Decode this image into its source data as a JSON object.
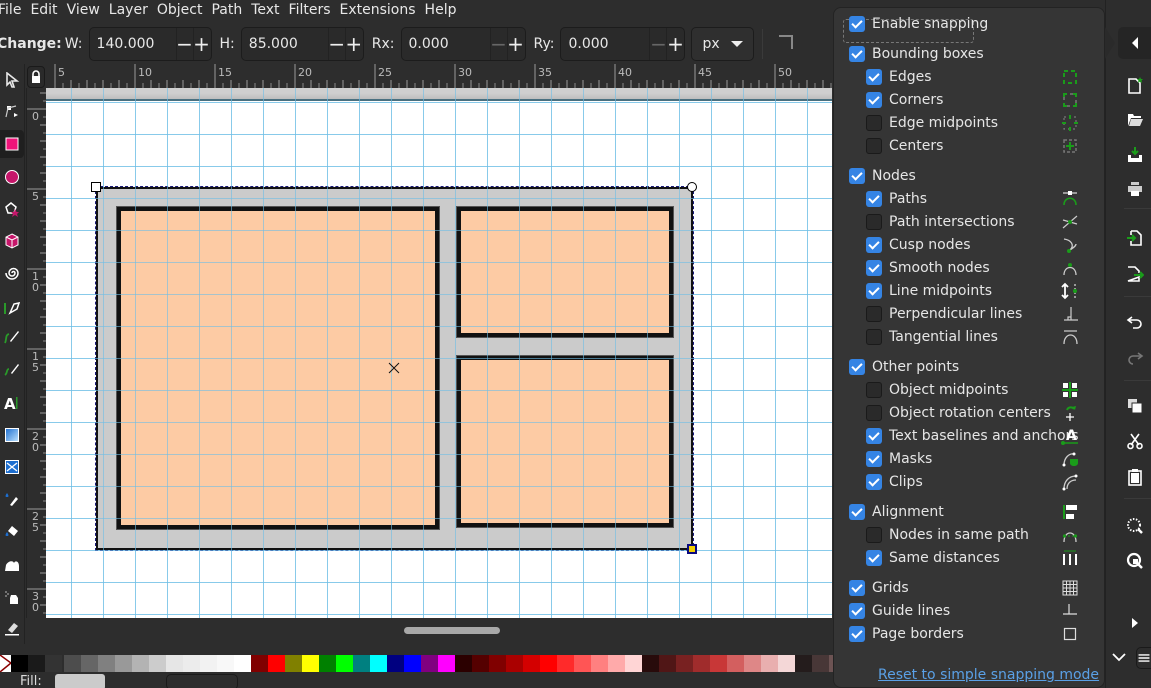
{
  "menubar": [
    "File",
    "Edit",
    "View",
    "Layer",
    "Object",
    "Path",
    "Text",
    "Filters",
    "Extensions",
    "Help"
  ],
  "toolbar": {
    "change_label": "Change:",
    "w_label": "W:",
    "w_value": "140.000",
    "h_label": "H:",
    "h_value": "85.000",
    "rx_label": "Rx:",
    "rx_value": "0.000",
    "ry_label": "Ry:",
    "ry_value": "0.000",
    "unit": "px"
  },
  "tools": [
    {
      "name": "selector-tool",
      "icon": "arrow-icon"
    },
    {
      "name": "node-tool",
      "icon": "node-icon"
    },
    {
      "name": "rectangle-tool",
      "icon": "rectangle-icon",
      "active": true
    },
    {
      "name": "ellipse-tool",
      "icon": "circle-icon"
    },
    {
      "name": "star-tool",
      "icon": "star-icon"
    },
    {
      "name": "3d-box-tool",
      "icon": "cube-icon"
    },
    {
      "name": "spiral-tool",
      "icon": "spiral-icon"
    },
    {
      "name": "pen-tool",
      "icon": "pen-icon"
    },
    {
      "name": "pencil-tool",
      "icon": "pencil-icon"
    },
    {
      "name": "calligraphy-tool",
      "icon": "calligraphy-icon"
    },
    {
      "name": "text-tool",
      "icon": "text-icon"
    },
    {
      "name": "gradient-tool",
      "icon": "gradient-icon"
    },
    {
      "name": "mesh-tool",
      "icon": "mesh-icon"
    },
    {
      "name": "dropper-tool",
      "icon": "dropper-icon"
    },
    {
      "name": "paint-bucket-tool",
      "icon": "bucket-icon"
    },
    {
      "name": "tweak-tool",
      "icon": "tweak-icon"
    },
    {
      "name": "spray-tool",
      "icon": "spray-icon"
    },
    {
      "name": "eraser-tool",
      "icon": "eraser-icon"
    }
  ],
  "rulers": {
    "horizontal": [
      "5",
      "10",
      "15",
      "20",
      "25",
      "30",
      "35",
      "40",
      "45",
      "50"
    ],
    "vertical": [
      "0",
      "5",
      "10",
      "15",
      "20",
      "25",
      "30"
    ]
  },
  "colors": {
    "accent": "#3584e4",
    "panel_fill": "#fdcba4",
    "frame_fill": "#cbcbcb",
    "link": "#5aa0e6",
    "snap_green": "#1a9c1a"
  },
  "snapping": {
    "enable": {
      "label": "Enable snapping",
      "checked": true
    },
    "groups": [
      {
        "label": "Bounding boxes",
        "checked": true,
        "items": [
          {
            "label": "Edges",
            "checked": true,
            "icon": "bbox-edges-icon"
          },
          {
            "label": "Corners",
            "checked": true,
            "icon": "bbox-corners-icon"
          },
          {
            "label": "Edge midpoints",
            "checked": false,
            "icon": "bbox-edge-midpoints-icon"
          },
          {
            "label": "Centers",
            "checked": false,
            "icon": "bbox-centers-icon"
          }
        ]
      },
      {
        "label": "Nodes",
        "checked": true,
        "items": [
          {
            "label": "Paths",
            "checked": true,
            "icon": "paths-icon"
          },
          {
            "label": "Path intersections",
            "checked": false,
            "icon": "path-intersections-icon"
          },
          {
            "label": "Cusp nodes",
            "checked": true,
            "icon": "cusp-nodes-icon"
          },
          {
            "label": "Smooth nodes",
            "checked": true,
            "icon": "smooth-nodes-icon"
          },
          {
            "label": "Line midpoints",
            "checked": true,
            "icon": "line-midpoints-icon"
          },
          {
            "label": "Perpendicular lines",
            "checked": false,
            "icon": "perpendicular-icon"
          },
          {
            "label": "Tangential lines",
            "checked": false,
            "icon": "tangential-icon"
          }
        ]
      },
      {
        "label": "Other points",
        "checked": true,
        "items": [
          {
            "label": "Object midpoints",
            "checked": false,
            "icon": "object-midpoints-icon"
          },
          {
            "label": "Object rotation centers",
            "checked": false,
            "icon": "rotation-center-icon"
          },
          {
            "label": "Text baselines and anchors",
            "checked": true,
            "icon": "text-baseline-icon"
          },
          {
            "label": "Masks",
            "checked": true,
            "icon": "mask-icon"
          },
          {
            "label": "Clips",
            "checked": true,
            "icon": "clip-icon"
          }
        ]
      },
      {
        "label": "Alignment",
        "checked": true,
        "items": [
          {
            "label": "Nodes in same path",
            "checked": false,
            "icon": "same-path-icon"
          },
          {
            "label": "Same distances",
            "checked": true,
            "icon": "same-distances-icon"
          }
        ]
      }
    ],
    "extras": [
      {
        "label": "Grids",
        "checked": true,
        "icon": "grid-icon"
      },
      {
        "label": "Guide lines",
        "checked": true,
        "icon": "guide-icon"
      },
      {
        "label": "Page borders",
        "checked": true,
        "icon": "page-border-icon"
      }
    ],
    "reset_link": "Reset to simple snapping mode"
  },
  "commands": [
    "new-document-icon",
    "open-icon",
    "save-icon",
    "print-icon",
    "import-icon",
    "export-icon",
    "undo-icon",
    "redo-icon",
    "duplicate-icon",
    "cut-icon",
    "paste-icon",
    "zoom-selection-icon",
    "zoom-drawing-icon"
  ],
  "palette": [
    "none",
    "#000000",
    "#1a1a1a",
    "#333333",
    "#4d4d4d",
    "#666666",
    "#808080",
    "#999999",
    "#b3b3b3",
    "#cccccc",
    "#e6e6e6",
    "#ececec",
    "#f2f2f2",
    "#f8f8f8",
    "#ffffff",
    "#800000",
    "#ff0000",
    "#808000",
    "#ffff00",
    "#008000",
    "#00ff00",
    "#008080",
    "#00ffff",
    "#000080",
    "#0000ff",
    "#800080",
    "#ff00ff",
    "#2b0000",
    "#550000",
    "#800000",
    "#aa0000",
    "#d40000",
    "#ff0000",
    "#ff2a2a",
    "#ff5555",
    "#ff8080",
    "#ffaaaa",
    "#ffd5d5",
    "#280b0b",
    "#501616",
    "#782121",
    "#a02c2c",
    "#c83737",
    "#d35f5f",
    "#de8787",
    "#e9afaf",
    "#f4d7d7",
    "#241c1c",
    "#483737",
    "#6c5353"
  ],
  "status": {
    "fill_label": "Fill:"
  }
}
